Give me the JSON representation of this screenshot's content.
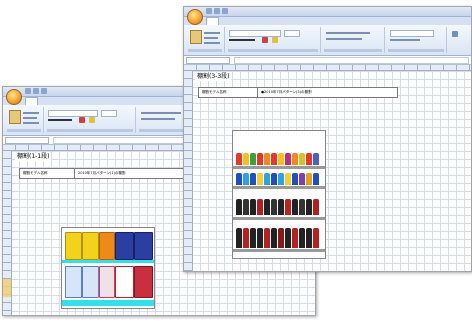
{
  "colors": {
    "ribbon_top": "#f4f8fd",
    "grid_line": "#d6dde8",
    "header_fill": "#e4ecf7",
    "shelf_price_strip": "#33e0e8",
    "row_highlight": "#f4cf6d"
  },
  "icons": {
    "office_button": "office-orb-icon",
    "quick_access": "save-undo-redo-icons",
    "paste": "paste-icon"
  },
  "back_window": {
    "sheet_title": "棚割(1-1段)",
    "info_row": {
      "label": "棚割モデル名称",
      "value": "2010年7月パターン(1)の棚割"
    }
  },
  "front_window": {
    "sheet_title": "棚割(3-3段)",
    "info_row": {
      "label": "棚割モデル名称",
      "value": "●2010年7月パターン(3)の棚割"
    }
  }
}
